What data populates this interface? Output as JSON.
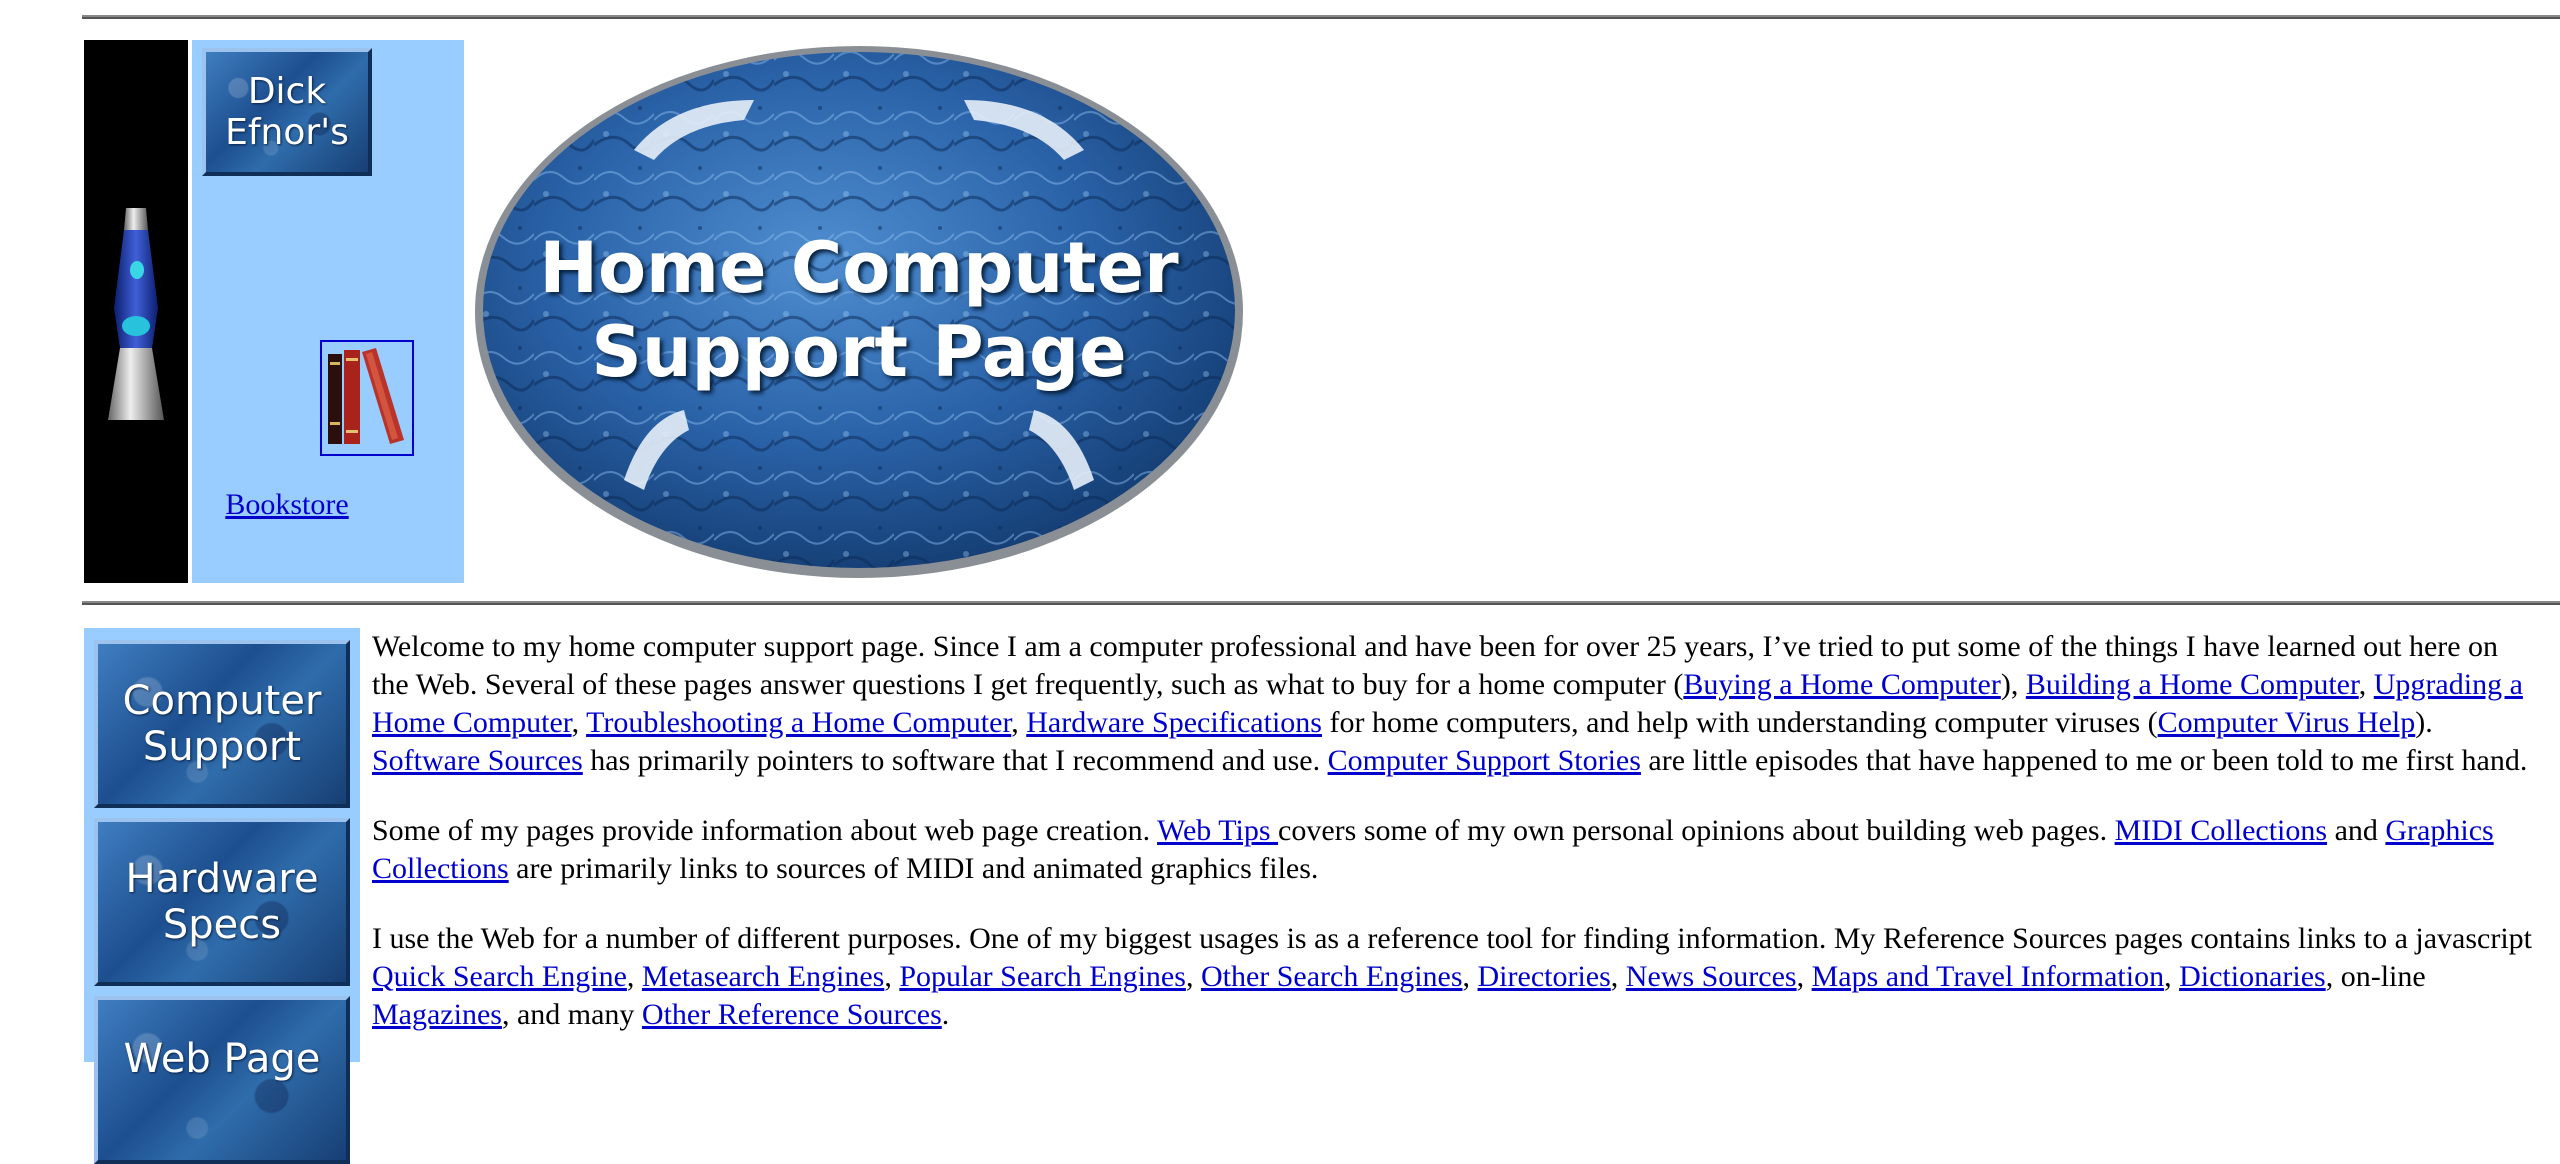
{
  "header": {
    "owner_button": "Dick\nEfnor's",
    "bookstore_link": "Bookstore",
    "logo_title": "Home Computer\nSupport Page"
  },
  "nav": {
    "computer_support": "Computer\nSupport",
    "hardware_specs": "Hardware\nSpecs",
    "web_page": "Web Page"
  },
  "content": {
    "p1": {
      "t1": "Welcome to my home computer support page. Since I am a computer professional and have been for over 25 years, I’ve tried to put some of the things I have learned out here on the Web. Several of these pages answer questions I get frequently, such as what to buy for a home computer (",
      "l1": "Buying a Home Computer",
      "t2": "), ",
      "l2": "Building a Home Computer",
      "t3": ", ",
      "l3": "Upgrading a Home Computer",
      "t4": ", ",
      "l4": "Troubleshooting a Home Computer",
      "t5": ", ",
      "l5": "Hardware Specifications",
      "t6": " for home computers, and help with understanding computer viruses (",
      "l6": "Computer Virus Help",
      "t7": "). ",
      "l7": "Software Sources",
      "t8": " has primarily pointers to software that I recommend and use. ",
      "l8": "Computer Support Stories",
      "t9": " are little episodes that have happened to me or been told to me first hand."
    },
    "p2": {
      "t1": "Some of my pages provide information about web page creation. ",
      "l1": "Web Tips ",
      "t2": "covers some of my own personal opinions about building web pages. ",
      "l2": "MIDI Collections",
      "t3": " and ",
      "l3": "Graphics Collections",
      "t4": " are primarily links to sources of MIDI and animated graphics files."
    },
    "p3": {
      "t1": "I use the Web for a number of different purposes. One of my biggest usages is as a reference tool for finding information. My Reference Sources pages contains links to a javascript ",
      "l1": "Quick Search Engine",
      "t2": ", ",
      "l2": "Metasearch Engines",
      "t3": ", ",
      "l3": "Popular Search Engines",
      "t4": ", ",
      "l4": "Other Search Engines",
      "t5": ", ",
      "l5": "Directories",
      "t6": ", ",
      "l6": "News Sources",
      "t7": ", ",
      "l7": "Maps and Travel Information",
      "t8": ", ",
      "l8": "Dictionaries",
      "t9": ", on-line ",
      "l9": "Magazines",
      "t10": ", and many ",
      "l10": "Other Reference Sources",
      "t11": "."
    }
  },
  "colors": {
    "link": "#0000cc",
    "side_panel": "#99ccff",
    "lamp_strip": "#000000"
  }
}
